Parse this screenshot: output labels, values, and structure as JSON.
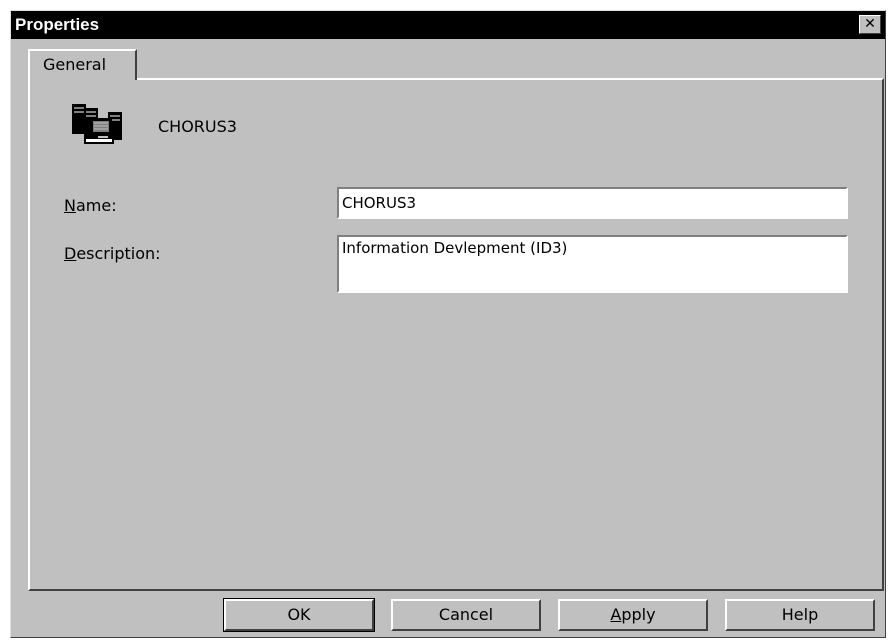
{
  "window": {
    "title": "Properties",
    "close_glyph": "✕"
  },
  "tabs": [
    {
      "label": "General",
      "selected": true
    }
  ],
  "general": {
    "object_icon": "server-computer-icon",
    "object_name": "CHORUS3",
    "name_label_mnemonic": "N",
    "name_label_rest": "ame:",
    "name_value": "CHORUS3",
    "description_label_mnemonic": "D",
    "description_label_rest": "escription:",
    "description_value": "Information Devlepment (ID3)"
  },
  "buttons": {
    "ok": "OK",
    "cancel": "Cancel",
    "apply_mnemonic": "A",
    "apply_rest": "pply",
    "help": "Help"
  },
  "colors": {
    "face": "#c0c0c0",
    "titlebar": "#000000",
    "field_bg": "#ffffff"
  }
}
